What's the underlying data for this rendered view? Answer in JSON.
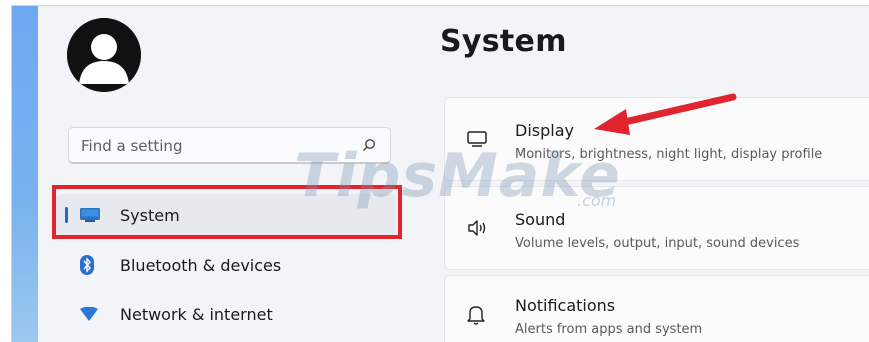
{
  "search": {
    "placeholder": "Find a setting"
  },
  "sidebar": {
    "items": [
      {
        "label": "System",
        "selected": true,
        "icon": "monitor-icon"
      },
      {
        "label": "Bluetooth & devices",
        "icon": "bluetooth-icon"
      },
      {
        "label": "Network & internet",
        "icon": "wifi-icon"
      }
    ]
  },
  "main": {
    "title": "System",
    "cards": [
      {
        "title": "Display",
        "subtitle": "Monitors, brightness, night light, display profile",
        "icon": "display-icon"
      },
      {
        "title": "Sound",
        "subtitle": "Volume levels, output, input, sound devices",
        "icon": "speaker-icon"
      },
      {
        "title": "Notifications",
        "subtitle": "Alerts from apps and system",
        "icon": "bell-icon"
      }
    ]
  },
  "watermark": {
    "text": "TipsMake",
    "suffix": ".com"
  },
  "colors": {
    "accent": "#2a63c9",
    "highlight": "#e0252e"
  }
}
